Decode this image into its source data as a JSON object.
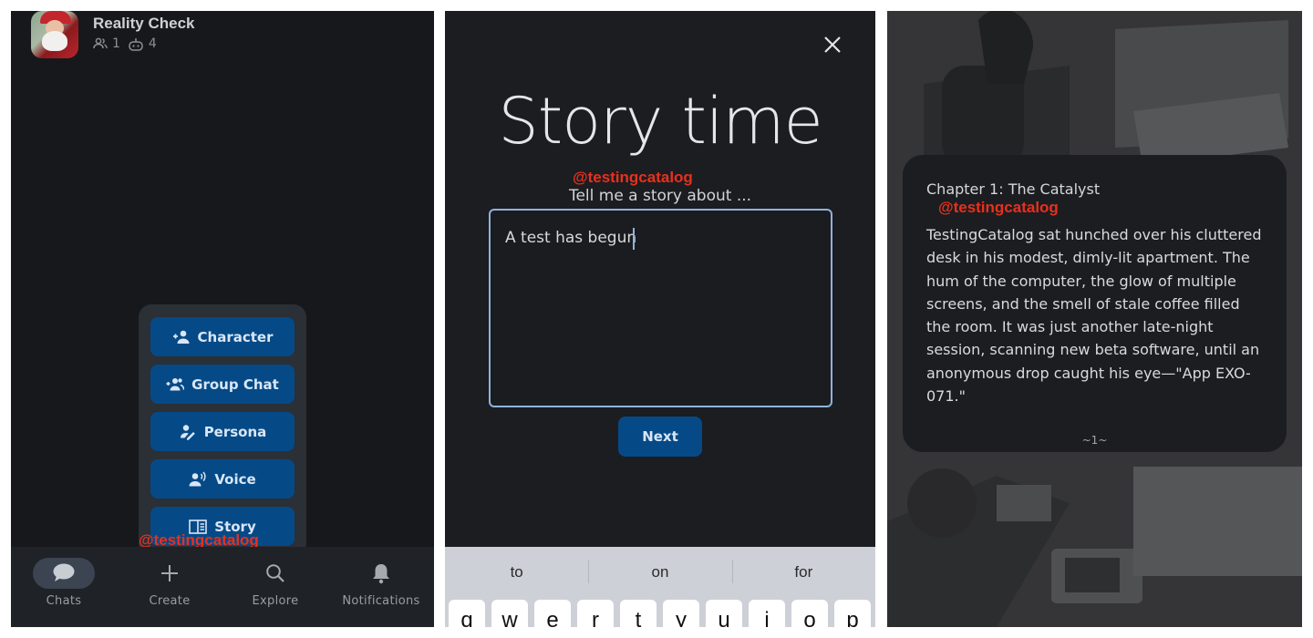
{
  "panel_chats": {
    "chat": {
      "title": "Reality Check",
      "members_count": "1",
      "bots_count": "4"
    },
    "create_menu": {
      "items": [
        {
          "label": "Character",
          "icon": "person-add-icon"
        },
        {
          "label": "Group Chat",
          "icon": "group-add-icon"
        },
        {
          "label": "Persona",
          "icon": "person-edit-icon"
        },
        {
          "label": "Voice",
          "icon": "voice-icon"
        },
        {
          "label": "Story",
          "icon": "book-icon"
        }
      ]
    },
    "watermark": "@testingcatalog",
    "bottom_nav": {
      "items": [
        {
          "label": "Chats",
          "icon": "chat-bubble-icon",
          "active": true
        },
        {
          "label": "Create",
          "icon": "plus-icon",
          "active": false
        },
        {
          "label": "Explore",
          "icon": "search-icon",
          "active": false
        },
        {
          "label": "Notifications",
          "icon": "bell-icon",
          "active": false
        }
      ]
    }
  },
  "panel_story": {
    "title": "Story time",
    "watermark": "@testingcatalog",
    "prompt_label": "Tell me a story about ...",
    "input_value": "A test has begun",
    "next_label": "Next",
    "keyboard": {
      "suggestions": [
        "to",
        "on",
        "for"
      ],
      "top_row": [
        "q",
        "w",
        "e",
        "r",
        "t",
        "y",
        "u",
        "i",
        "o",
        "p"
      ]
    }
  },
  "panel_chapter": {
    "chapter_title": "Chapter 1: The Catalyst",
    "watermark": "@testingcatalog",
    "body": "TestingCatalog sat hunched over his cluttered desk in his modest, dimly-lit apartment. The hum of the computer, the glow of multiple screens, and the smell of stale coffee filled the room. It was just another late-night session, scanning new beta software, until an anonymous drop caught his eye—\"App EXO-071.\"",
    "page_indicator": "~1~"
  },
  "colors": {
    "accent_button": "#054a87",
    "input_border": "#8fb2de",
    "watermark": "#e8301e"
  }
}
